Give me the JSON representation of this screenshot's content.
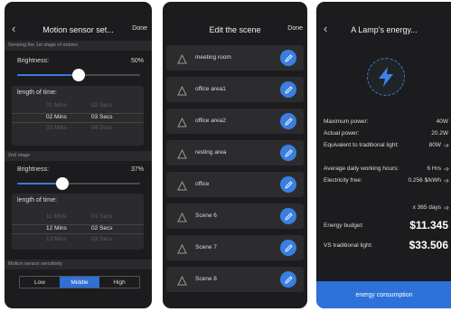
{
  "colors": {
    "accent": "#2f6fd6",
    "panel": "#2b2b2e",
    "background": "#1c1c1e"
  },
  "motion": {
    "back_icon": "chevron-left-icon",
    "title": "Motion sensor set...",
    "done": "Done",
    "stage1_label": "Sensing the 1st stage of motion",
    "stage1_brightness_label": "Brightness:",
    "stage1_brightness_value": "50%",
    "stage1_brightness_fraction": 0.5,
    "stage1_length_label": "length of time:",
    "stage1_picker": [
      [
        "01 Mins",
        "02 Secs"
      ],
      [
        "02 Mins",
        "03 Secs"
      ],
      [
        "03 Mins",
        "04 Secs"
      ]
    ],
    "stage2_label": "2nd stage",
    "stage2_brightness_label": "Brightness:",
    "stage2_brightness_value": "37%",
    "stage2_brightness_fraction": 0.37,
    "stage2_length_label": "length of time:",
    "stage2_picker": [
      [
        "11 Mins",
        "01 Secs"
      ],
      [
        "12 Mins",
        "02 Secs"
      ],
      [
        "13 Mins",
        "03 Secs"
      ]
    ],
    "sensitivity_label": "Motion sensor sensitivity",
    "sensitivity_options": [
      "Low",
      "Middle",
      "High"
    ],
    "sensitivity_selected": "Middle"
  },
  "scenes": {
    "title": "Edit the scene",
    "done": "Done",
    "items": [
      {
        "label": "meeting room"
      },
      {
        "label": "office area1"
      },
      {
        "label": "office area2"
      },
      {
        "label": "resting area"
      },
      {
        "label": "office"
      },
      {
        "label": "Scene 6"
      },
      {
        "label": "Scene 7"
      },
      {
        "label": "Scene 8"
      }
    ]
  },
  "energy": {
    "title": "A Lamp's energy...",
    "back_icon": "chevron-left-icon",
    "bolt_icon": "lightning-bolt-icon",
    "max_power_label": "Maximum power:",
    "max_power_value": "40W",
    "actual_power_label": "Actual power:",
    "actual_power_value": "20.2W",
    "equiv_label": "Equivalent to traditional light:",
    "equiv_value": "80W",
    "hours_label": "Average daily working hours:",
    "hours_value": "6 Hrs",
    "fee_label": "Electricity free:",
    "fee_value": "0.256 $/kWh",
    "days_value": "x 365 days",
    "budget_label": "Energy budget:",
    "budget_value": "$11.345",
    "vs_label": "VS traditional light:",
    "vs_value": "$33.506",
    "button": "energy consumption"
  }
}
